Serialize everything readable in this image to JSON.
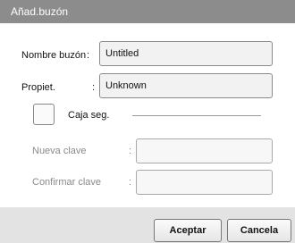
{
  "window": {
    "title": "Añad.buzón"
  },
  "form": {
    "name_label": "Nombre buzón",
    "name_colon": ":",
    "name_value": "Untitled",
    "owner_label": "Propiet.",
    "owner_colon": ":",
    "owner_value": "Unknown",
    "secure_label": "Caja seg.",
    "new_password_label": "Nueva clave",
    "new_password_colon": ":",
    "confirm_password_label": "Confirmar clave",
    "confirm_password_colon": ":"
  },
  "buttons": {
    "accept": "Aceptar",
    "cancel": "Cancela"
  }
}
